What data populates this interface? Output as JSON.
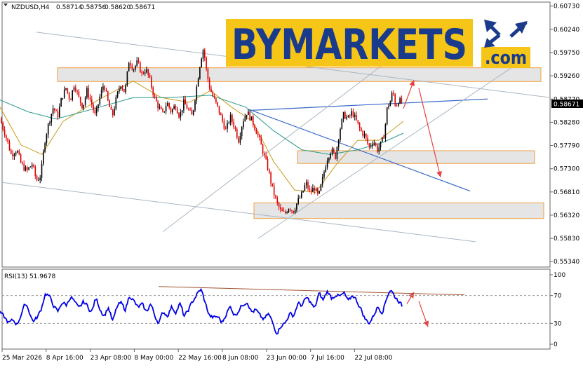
{
  "header": {
    "symbol": "NZDUSD,H4",
    "open": "0.58714",
    "high": "0.58756",
    "low": "0.58620",
    "close": "0.58671"
  },
  "watermark": {
    "brand": "BYMARKETS",
    "domain": ".com"
  },
  "colors": {
    "bull": "#000000",
    "bear": "#dd0000",
    "ma_fast": "#c89a18",
    "ma_slow": "#2a9a8a",
    "rsi_line": "#0000e6",
    "zone_fill": "#e0e0e0",
    "zone_border": "#f0a040",
    "trend_blue": "#3a6bc8",
    "channel_grey": "#a9b6c4",
    "arrow_red": "#e84040",
    "logo_yellow": "#f5c518",
    "logo_blue": "#1a3a8c"
  },
  "chart_data": [
    {
      "type": "candlestick",
      "instrument": "NZDUSD",
      "timeframe": "H4",
      "y_ticks": [
        "0.60730",
        "0.60240",
        "0.59750",
        "0.59260",
        "0.58770",
        "0.58280",
        "0.57790",
        "0.57300",
        "0.56810",
        "0.56320",
        "0.55830",
        "0.55340"
      ],
      "ylim": [
        0.5524,
        0.608
      ],
      "x_ticks": [
        "25 Mar 2026",
        "8 Apr 16:00",
        "23 Apr 08:00",
        "8 May 00:00",
        "22 May 16:00",
        "8 Jun 08:00",
        "23 Jun 00:00",
        "7 Jul 16:00",
        "22 Jul 08:00"
      ],
      "current_price": "0.58671",
      "price_path": [
        [
          0,
          0.5835
        ],
        [
          8,
          0.58
        ],
        [
          16,
          0.576
        ],
        [
          24,
          0.577
        ],
        [
          30,
          0.574
        ],
        [
          38,
          0.5725
        ],
        [
          46,
          0.574
        ],
        [
          52,
          0.5705
        ],
        [
          58,
          0.5715
        ],
        [
          64,
          0.579
        ],
        [
          70,
          0.583
        ],
        [
          76,
          0.586
        ],
        [
          82,
          0.584
        ],
        [
          88,
          0.588
        ],
        [
          94,
          0.59
        ],
        [
          100,
          0.5875
        ],
        [
          106,
          0.591
        ],
        [
          112,
          0.588
        ],
        [
          118,
          0.586
        ],
        [
          124,
          0.5895
        ],
        [
          130,
          0.587
        ],
        [
          136,
          0.584
        ],
        [
          142,
          0.588
        ],
        [
          148,
          0.591
        ],
        [
          154,
          0.587
        ],
        [
          160,
          0.584
        ],
        [
          166,
          0.588
        ],
        [
          172,
          0.591
        ],
        [
          178,
          0.589
        ],
        [
          184,
          0.596
        ],
        [
          190,
          0.594
        ],
        [
          196,
          0.5955
        ],
        [
          202,
          0.593
        ],
        [
          208,
          0.594
        ],
        [
          214,
          0.5915
        ],
        [
          220,
          0.588
        ],
        [
          226,
          0.586
        ],
        [
          232,
          0.5845
        ],
        [
          238,
          0.587
        ],
        [
          244,
          0.585
        ],
        [
          250,
          0.5865
        ],
        [
          256,
          0.584
        ],
        [
          262,
          0.587
        ],
        [
          268,
          0.5855
        ],
        [
          274,
          0.584
        ],
        [
          280,
          0.59
        ],
        [
          286,
          0.596
        ],
        [
          290,
          0.5985
        ],
        [
          294,
          0.594
        ],
        [
          298,
          0.5905
        ],
        [
          304,
          0.588
        ],
        [
          310,
          0.586
        ],
        [
          316,
          0.5835
        ],
        [
          322,
          0.581
        ],
        [
          328,
          0.584
        ],
        [
          334,
          0.582
        ],
        [
          340,
          0.579
        ],
        [
          346,
          0.583
        ],
        [
          352,
          0.585
        ],
        [
          358,
          0.5835
        ],
        [
          364,
          0.5815
        ],
        [
          370,
          0.579
        ],
        [
          376,
          0.576
        ],
        [
          382,
          0.573
        ],
        [
          388,
          0.569
        ],
        [
          394,
          0.566
        ],
        [
          400,
          0.564
        ],
        [
          406,
          0.5635
        ],
        [
          412,
          0.565
        ],
        [
          418,
          0.564
        ],
        [
          424,
          0.566
        ],
        [
          430,
          0.5675
        ],
        [
          436,
          0.57
        ],
        [
          442,
          0.568
        ],
        [
          448,
          0.569
        ],
        [
          454,
          0.567
        ],
        [
          460,
          0.571
        ],
        [
          466,
          0.575
        ],
        [
          472,
          0.577
        ],
        [
          478,
          0.5755
        ],
        [
          484,
          0.581
        ],
        [
          490,
          0.5845
        ],
        [
          496,
          0.5835
        ],
        [
          502,
          0.585
        ],
        [
          508,
          0.583
        ],
        [
          514,
          0.581
        ],
        [
          520,
          0.58
        ],
        [
          526,
          0.5775
        ],
        [
          532,
          0.579
        ],
        [
          538,
          0.577
        ],
        [
          544,
          0.5785
        ],
        [
          548,
          0.5805
        ],
        [
          552,
          0.586
        ],
        [
          556,
          0.587
        ],
        [
          560,
          0.5895
        ],
        [
          564,
          0.586
        ],
        [
          568,
          0.5875
        ],
        [
          574,
          0.5867
        ]
      ],
      "moving_averages": [
        {
          "role": "fast",
          "points": [
            [
              0,
              0.586
            ],
            [
              30,
              0.578
            ],
            [
              60,
              0.576
            ],
            [
              90,
              0.583
            ],
            [
              140,
              0.5875
            ],
            [
              190,
              0.5915
            ],
            [
              230,
              0.588
            ],
            [
              270,
              0.587
            ],
            [
              300,
              0.5895
            ],
            [
              330,
              0.586
            ],
            [
              360,
              0.583
            ],
            [
              390,
              0.5745
            ],
            [
              420,
              0.5685
            ],
            [
              450,
              0.568
            ],
            [
              480,
              0.574
            ],
            [
              510,
              0.579
            ],
            [
              540,
              0.579
            ],
            [
              575,
              0.583
            ]
          ]
        },
        {
          "role": "slow",
          "points": [
            [
              0,
              0.5875
            ],
            [
              40,
              0.585
            ],
            [
              80,
              0.5835
            ],
            [
              130,
              0.5855
            ],
            [
              190,
              0.588
            ],
            [
              240,
              0.588
            ],
            [
              300,
              0.5885
            ],
            [
              350,
              0.586
            ],
            [
              390,
              0.581
            ],
            [
              430,
              0.577
            ],
            [
              470,
              0.576
            ],
            [
              510,
              0.577
            ],
            [
              545,
              0.5785
            ],
            [
              575,
              0.5805
            ]
          ]
        }
      ],
      "zones": [
        {
          "x0": 82,
          "x1": 771,
          "y_top": 0.5943,
          "y_bottom": 0.5914
        },
        {
          "x0": 424,
          "x1": 762,
          "y_top": 0.5768,
          "y_bottom": 0.5741
        },
        {
          "x0": 362,
          "x1": 775,
          "y_top": 0.5658,
          "y_bottom": 0.5625
        }
      ],
      "trend_lines": [
        {
          "style": "blue",
          "from": [
            355,
            0.5853
          ],
          "to": [
            695,
            0.5877
          ]
        },
        {
          "style": "blue",
          "from": [
            355,
            0.5855
          ],
          "to": [
            670,
            0.5683
          ]
        },
        {
          "style": "grey",
          "from": [
            52,
            0.6018
          ],
          "to": [
            785,
            0.588
          ]
        },
        {
          "style": "grey",
          "from": [
            3,
            0.5701
          ],
          "to": [
            678,
            0.5576
          ]
        },
        {
          "style": "grey",
          "from": [
            232,
            0.5597
          ],
          "to": [
            582,
            0.599
          ]
        },
        {
          "style": "grey",
          "from": [
            368,
            0.5583
          ],
          "to": [
            748,
            0.5962
          ]
        }
      ],
      "arrows": [
        {
          "from": [
            575,
            0.5857
          ],
          "to": [
            590,
            0.5917
          ]
        },
        {
          "from": [
            597,
            0.59
          ],
          "to": [
            628,
            0.5712
          ]
        }
      ]
    },
    {
      "type": "line",
      "title": "RSI(13) 51.9678",
      "y_ticks": [
        "100",
        "70",
        "30",
        "0"
      ],
      "ylim": [
        -6,
        107
      ],
      "levels": [
        70,
        30
      ],
      "rsi_path": [
        [
          0,
          45
        ],
        [
          6,
          38
        ],
        [
          12,
          30
        ],
        [
          18,
          35
        ],
        [
          24,
          28
        ],
        [
          30,
          45
        ],
        [
          36,
          60
        ],
        [
          40,
          50
        ],
        [
          46,
          32
        ],
        [
          52,
          38
        ],
        [
          58,
          50
        ],
        [
          64,
          75
        ],
        [
          70,
          68
        ],
        [
          76,
          55
        ],
        [
          82,
          45
        ],
        [
          88,
          62
        ],
        [
          94,
          55
        ],
        [
          100,
          70
        ],
        [
          106,
          60
        ],
        [
          112,
          50
        ],
        [
          118,
          62
        ],
        [
          124,
          55
        ],
        [
          130,
          45
        ],
        [
          136,
          68
        ],
        [
          142,
          50
        ],
        [
          148,
          40
        ],
        [
          154,
          55
        ],
        [
          160,
          30
        ],
        [
          166,
          55
        ],
        [
          172,
          60
        ],
        [
          178,
          48
        ],
        [
          184,
          72
        ],
        [
          190,
          62
        ],
        [
          196,
          52
        ],
        [
          202,
          58
        ],
        [
          208,
          45
        ],
        [
          214,
          60
        ],
        [
          220,
          40
        ],
        [
          226,
          30
        ],
        [
          232,
          48
        ],
        [
          238,
          40
        ],
        [
          244,
          55
        ],
        [
          250,
          45
        ],
        [
          256,
          60
        ],
        [
          262,
          38
        ],
        [
          268,
          50
        ],
        [
          274,
          62
        ],
        [
          280,
          72
        ],
        [
          286,
          80
        ],
        [
          292,
          58
        ],
        [
          298,
          40
        ],
        [
          304,
          38
        ],
        [
          310,
          40
        ],
        [
          316,
          30
        ],
        [
          322,
          45
        ],
        [
          328,
          55
        ],
        [
          334,
          40
        ],
        [
          340,
          50
        ],
        [
          346,
          58
        ],
        [
          352,
          62
        ],
        [
          358,
          45
        ],
        [
          364,
          50
        ],
        [
          370,
          40
        ],
        [
          376,
          35
        ],
        [
          382,
          45
        ],
        [
          388,
          30
        ],
        [
          394,
          15
        ],
        [
          400,
          28
        ],
        [
          406,
          30
        ],
        [
          412,
          45
        ],
        [
          418,
          40
        ],
        [
          424,
          60
        ],
        [
          430,
          55
        ],
        [
          436,
          68
        ],
        [
          442,
          60
        ],
        [
          448,
          50
        ],
        [
          454,
          75
        ],
        [
          460,
          62
        ],
        [
          466,
          78
        ],
        [
          472,
          65
        ],
        [
          478,
          72
        ],
        [
          484,
          68
        ],
        [
          490,
          74
        ],
        [
          496,
          60
        ],
        [
          502,
          72
        ],
        [
          508,
          62
        ],
        [
          514,
          50
        ],
        [
          520,
          35
        ],
        [
          526,
          30
        ],
        [
          532,
          42
        ],
        [
          538,
          55
        ],
        [
          544,
          45
        ],
        [
          548,
          58
        ],
        [
          552,
          72
        ],
        [
          556,
          80
        ],
        [
          562,
          68
        ],
        [
          568,
          62
        ],
        [
          574,
          52
        ]
      ],
      "trend_line": {
        "from": [
          226,
          83
        ],
        "to": [
          662,
          71
        ]
      },
      "arrows": [
        {
          "from": [
            580,
            58
          ],
          "to": [
            590,
            75
          ]
        },
        {
          "from": [
            597,
            62
          ],
          "to": [
            610,
            25
          ]
        }
      ]
    }
  ]
}
